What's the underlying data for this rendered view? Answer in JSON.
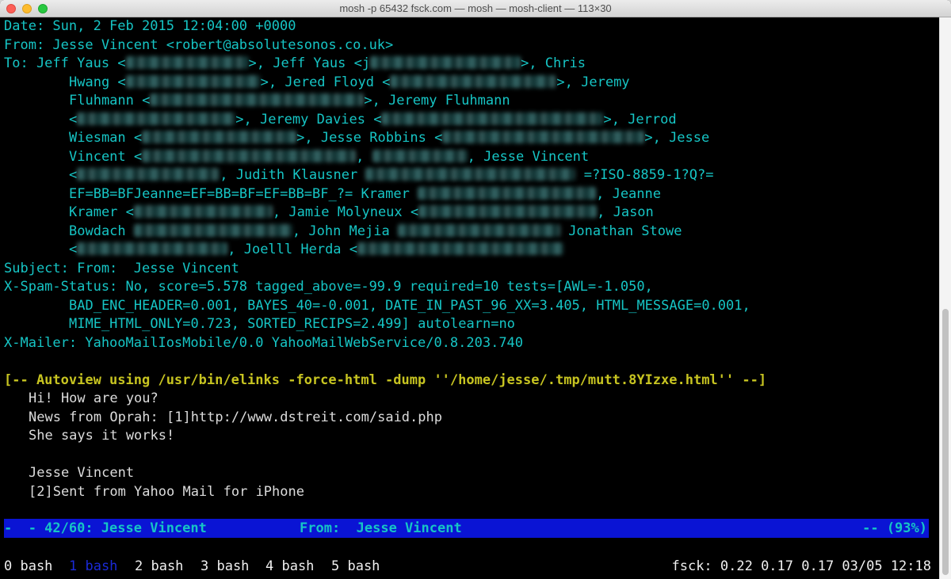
{
  "window": {
    "title": "mosh -p 65432 fsck.com — mosh — mosh-client — 113×30"
  },
  "headers": {
    "date": "Date: Sun, 2 Feb 2015 12:04:00 +0000",
    "from": "From: Jesse Vincent <robert@absolutesonos.co.uk>",
    "to": [
      {
        "segments": [
          {
            "t": "To: Jeff Yaus <"
          },
          {
            "blur": 155
          },
          {
            "t": ">, Jeff Yaus <j"
          },
          {
            "blur": 190
          },
          {
            "t": ">, Chris"
          }
        ]
      },
      {
        "segments": [
          {
            "t": "Hwang <"
          },
          {
            "blur": 170
          },
          {
            "t": ">, Jered Floyd <"
          },
          {
            "blur": 210
          },
          {
            "t": ">, Jeremy"
          }
        ]
      },
      {
        "segments": [
          {
            "t": "Fluhmann <"
          },
          {
            "blur": 270
          },
          {
            "t": ">, Jeremy Fluhmann"
          }
        ]
      },
      {
        "segments": [
          {
            "t": "<"
          },
          {
            "blur": 200
          },
          {
            "t": ">, Jeremy Davies <"
          },
          {
            "blur": 280
          },
          {
            "t": ">, Jerrod"
          }
        ]
      },
      {
        "segments": [
          {
            "t": "Wiesman <"
          },
          {
            "blur": 195
          },
          {
            "t": ">, Jesse Robbins <"
          },
          {
            "blur": 255
          },
          {
            "t": ">, Jesse"
          }
        ]
      },
      {
        "segments": [
          {
            "t": "Vincent <"
          },
          {
            "blur": 270
          },
          {
            "t": ", "
          },
          {
            "blur": 120
          },
          {
            "t": ", Jesse Vincent"
          }
        ]
      },
      {
        "segments": [
          {
            "t": "<"
          },
          {
            "blur": 180
          },
          {
            "t": ", Judith Klausner "
          },
          {
            "blur": 265
          },
          {
            "t": " =?ISO-8859-1?Q?="
          }
        ]
      },
      {
        "segments": [
          {
            "t": "EF=BB=BFJeanne=EF=BB=BF=EF=BB=BF_?= Kramer "
          },
          {
            "blur": 225
          },
          {
            "t": ", Jeanne"
          }
        ]
      },
      {
        "segments": [
          {
            "t": "Kramer <"
          },
          {
            "blur": 175
          },
          {
            "t": ", Jamie Molyneux <"
          },
          {
            "blur": 225
          },
          {
            "t": ", Jason"
          }
        ]
      },
      {
        "segments": [
          {
            "t": "Bowdach "
          },
          {
            "blur": 200
          },
          {
            "t": ", John Mejia "
          },
          {
            "blur": 205
          },
          {
            "t": " Jonathan Stowe"
          }
        ]
      },
      {
        "segments": [
          {
            "t": "<"
          },
          {
            "blur": 190
          },
          {
            "t": ", Joelll Herda <"
          },
          {
            "blur": 260
          }
        ]
      }
    ],
    "subject": "Subject: From:  Jesse Vincent",
    "spam": [
      "X-Spam-Status: No, score=5.578 tagged_above=-99.9 required=10 tests=[AWL=-1.050,",
      "BAD_ENC_HEADER=0.001, BAYES_40=-0.001, DATE_IN_PAST_96_XX=3.405, HTML_MESSAGE=0.001,",
      "MIME_HTML_ONLY=0.723, SORTED_RECIPS=2.499] autolearn=no"
    ],
    "mailer": "X-Mailer: YahooMailIosMobile/0.0 YahooMailWebService/0.8.203.740"
  },
  "autoview": "[-- Autoview using /usr/bin/elinks -force-html -dump ''/home/jesse/.tmp/mutt.8YIzxe.html'' --]",
  "body_lines": [
    "Hi! How are you?",
    "News from Oprah: [1]http://www.dstreit.com/said.php",
    "She says it works!",
    "",
    "Jesse Vincent",
    "[2]Sent from Yahoo Mail for iPhone"
  ],
  "statusbar": {
    "left": "-  - 42/60: Jesse Vincent",
    "middle": "From:  Jesse Vincent",
    "right": "-- (93%)"
  },
  "tmux": {
    "windows": [
      "0 bash",
      "1 bash",
      "2 bash",
      "3 bash",
      "4 bash",
      "5 bash"
    ],
    "current_index": 1,
    "status_right": "fsck: 0.22 0.17 0.17 03/05 12:18"
  },
  "colors": {
    "header_text": "#16c5c5",
    "body_text": "#dcdcdc",
    "autoview_text": "#c7c421",
    "statusbar_bg": "#0a14d4",
    "terminal_bg": "#000000"
  }
}
